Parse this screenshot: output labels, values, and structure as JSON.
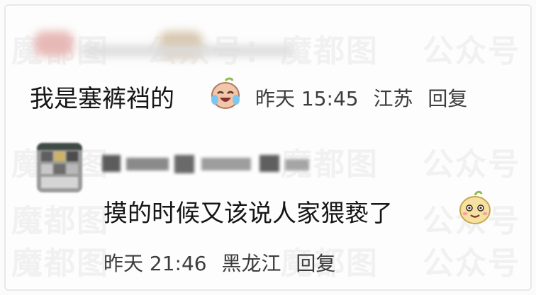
{
  "watermark": {
    "text": "魔都图 公众号"
  },
  "comments": [
    {
      "text": "我是塞裤裆的",
      "emoji": "crying-laughing-emoji",
      "time": "昨天 15:45",
      "location": "江苏",
      "reply_label": "回复"
    },
    {
      "text": "摸的时候又该说人家猥亵了",
      "emoji": "smirk-emoji",
      "time": "昨天 21:46",
      "location": "黑龙江",
      "reply_label": "回复"
    }
  ],
  "colors": {
    "text": "#161616",
    "meta": "#3d3d3d",
    "watermark": "#aaaaaa"
  }
}
